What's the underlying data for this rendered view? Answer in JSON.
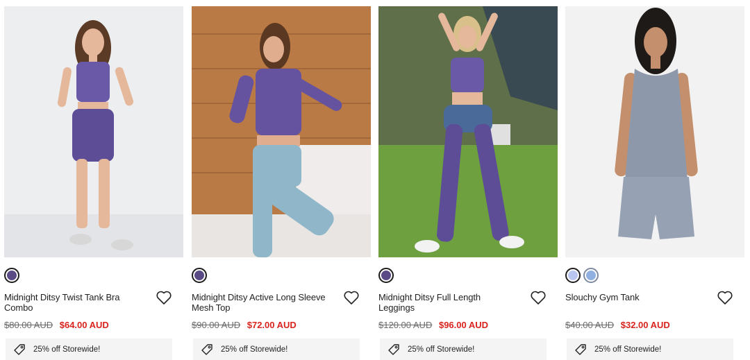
{
  "products": [
    {
      "name": "Midnight Ditsy Twist Tank Bra Combo",
      "was_price": "$80.00 AUD",
      "price": "$64.00 AUD",
      "promo": "25% off Storewide!",
      "swatches": [
        "#5a4a86"
      ],
      "image_alt": "Model in matching purple print crop tank and bike shorts"
    },
    {
      "name": "Midnight Ditsy Active Long Sleeve Mesh Top",
      "was_price": "$90.00 AUD",
      "price": "$72.00 AUD",
      "promo": "25% off Storewide!",
      "swatches": [
        "#5a4a86"
      ],
      "image_alt": "Model in purple mesh long sleeve top and light blue track pants"
    },
    {
      "name": "Midnight Ditsy Full Length Leggings",
      "was_price": "$120.00 AUD",
      "price": "$96.00 AUD",
      "promo": "25% off Storewide!",
      "swatches": [
        "#5a4a86"
      ],
      "image_alt": "Model outdoors in purple print leggings and crop top"
    },
    {
      "name": "Slouchy Gym Tank",
      "was_price": "$40.00 AUD",
      "price": "$32.00 AUD",
      "promo": "25% off Storewide!",
      "swatches": [
        "#b9c6ef",
        "#8fb0e0"
      ],
      "image_alt": "Model in grey slouchy tank and shorts"
    }
  ],
  "colors": {
    "sale_price": "#d9231d",
    "was_price": "#6b6b6b",
    "promo_bg": "#f4f4f4"
  },
  "icons": {
    "wishlist": "heart-outline-icon",
    "promo": "price-tag-icon"
  }
}
